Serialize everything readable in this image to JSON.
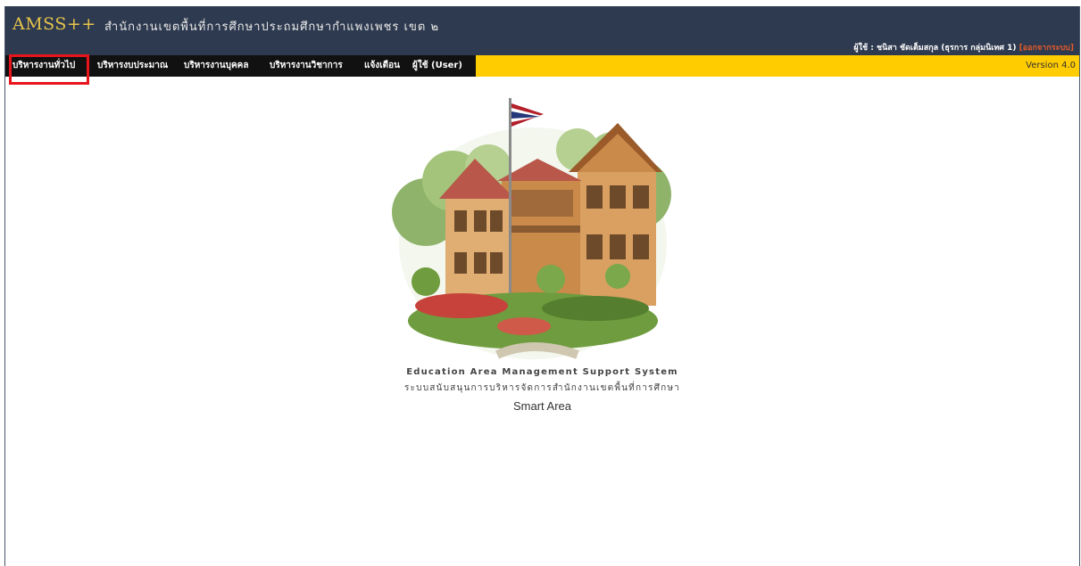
{
  "header": {
    "brand": "AMSS++",
    "org_name": "สำนักงานเขตพื้นที่การศึกษาประถมศึกษากำแพงเพชร เขต ๒",
    "user_label": "ผู้ใช้ : ชนิสา ชัดเต็มสกุล (ธุรการ กลุ่มนิเทศ 1)",
    "logout_label": "[ออกจากระบบ]"
  },
  "menu": {
    "items": [
      {
        "label": "บริหารงานทั่วไป"
      },
      {
        "label": "บริหารงบประมาณ"
      },
      {
        "label": "บริหารงานบุคคล"
      },
      {
        "label": "บริหารงานวิชาการ"
      },
      {
        "label": "แจ้งเตือน"
      },
      {
        "label": "ผู้ใช้ (User)"
      }
    ],
    "version": "Version 4.0"
  },
  "main": {
    "caption_en": "Education Area Management Support System",
    "caption_th": "ระบบสนับสนุนการบริหารจัดการสำนักงานเขตพื้นที่การศึกษา",
    "tagline": "Smart Area"
  },
  "colors": {
    "header_bg": "#2e3a4f",
    "brand": "#e6c44a",
    "menu_bar": "#ffcc00",
    "menu_dark": "#111111",
    "highlight": "#e8141c",
    "logout": "#e25a2a"
  },
  "icons": {
    "illustration": "school-building-with-flag"
  }
}
